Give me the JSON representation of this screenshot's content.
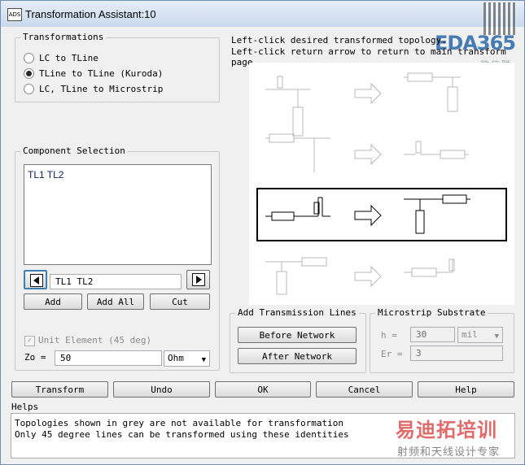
{
  "window": {
    "title": "Transformation Assistant:10"
  },
  "watermark": {
    "logo": "EDA365",
    "sub": "微信联系",
    "cn": "易迪拓培训",
    "cn_sub": "射频和天线设计专家"
  },
  "instructions": {
    "line1": "Left-click desired transformed topology.",
    "line2": "Left-click return arrow to return to main transform page."
  },
  "transformations": {
    "label": "Transformations",
    "options": [
      {
        "label": "LC to TLine",
        "selected": false
      },
      {
        "label": "TLine to TLine (Kuroda)",
        "selected": true
      },
      {
        "label": "LC, TLine to Microstrip",
        "selected": false
      }
    ]
  },
  "component_selection": {
    "label": "Component Selection",
    "list_items": [
      "TL1 TL2"
    ],
    "selected_value": "TL1 TL2",
    "buttons": {
      "add": "Add",
      "add_all": "Add All",
      "cut": "Cut"
    }
  },
  "unit_element": {
    "label": "Unit Element (45 deg)",
    "checked": true
  },
  "zo": {
    "label": "Zo =",
    "value": "50",
    "unit": "Ohm"
  },
  "add_tlines": {
    "label": "Add Transmission Lines",
    "before": "Before Network",
    "after": "After Network"
  },
  "substrate": {
    "label": "Microstrip Substrate",
    "h_label": "h =",
    "h_value": "30",
    "h_unit": "mil",
    "er_label": "Er =",
    "er_value": "3"
  },
  "actions": {
    "transform": "Transform",
    "undo": "Undo",
    "ok": "OK",
    "cancel": "Cancel",
    "help": "Help"
  },
  "helps": {
    "label": "Helps",
    "lines": [
      "Topologies shown in grey are not available for transformation",
      "Only 45 degree lines can be transformed using these identities"
    ]
  }
}
